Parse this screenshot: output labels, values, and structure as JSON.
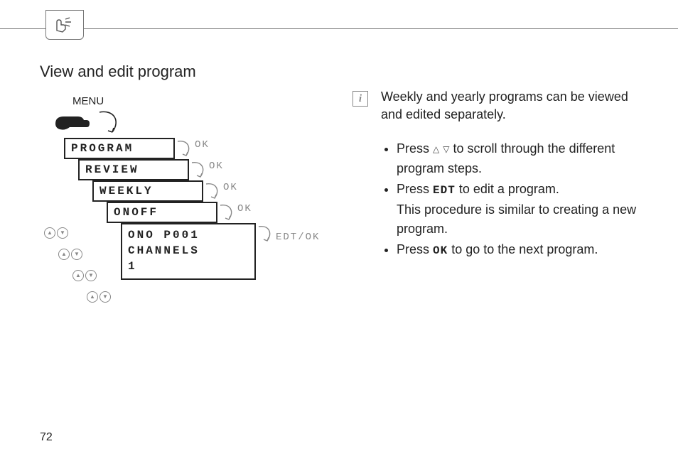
{
  "header": {
    "tab_icon": "touch-hand-icon"
  },
  "section_title": "View and edit program",
  "menu_label": "MENU",
  "lcd": {
    "step1": "PROGRAM",
    "step2": "REVIEW",
    "step3": "WEEKLY",
    "step4": "ONOFF",
    "step5_line1": "ONO  P001",
    "step5_line2": "CHANNELS",
    "step5_line3": "1",
    "ok": "OK",
    "edt_ok": "EDT/OK"
  },
  "info_note": "Weekly and yearly programs can be viewed and edited separately.",
  "bullets": {
    "b1_pre": "Press ",
    "b1_post": " to scroll through the different program steps.",
    "b2_pre": "Press ",
    "b2_key": "EDT",
    "b2_mid": " to edit a program.",
    "b2_line2": "This procedure is similar to creating a new program.",
    "b3_pre": "Press ",
    "b3_key": "OK",
    "b3_post": " to go to the next program."
  },
  "page_number": "72"
}
